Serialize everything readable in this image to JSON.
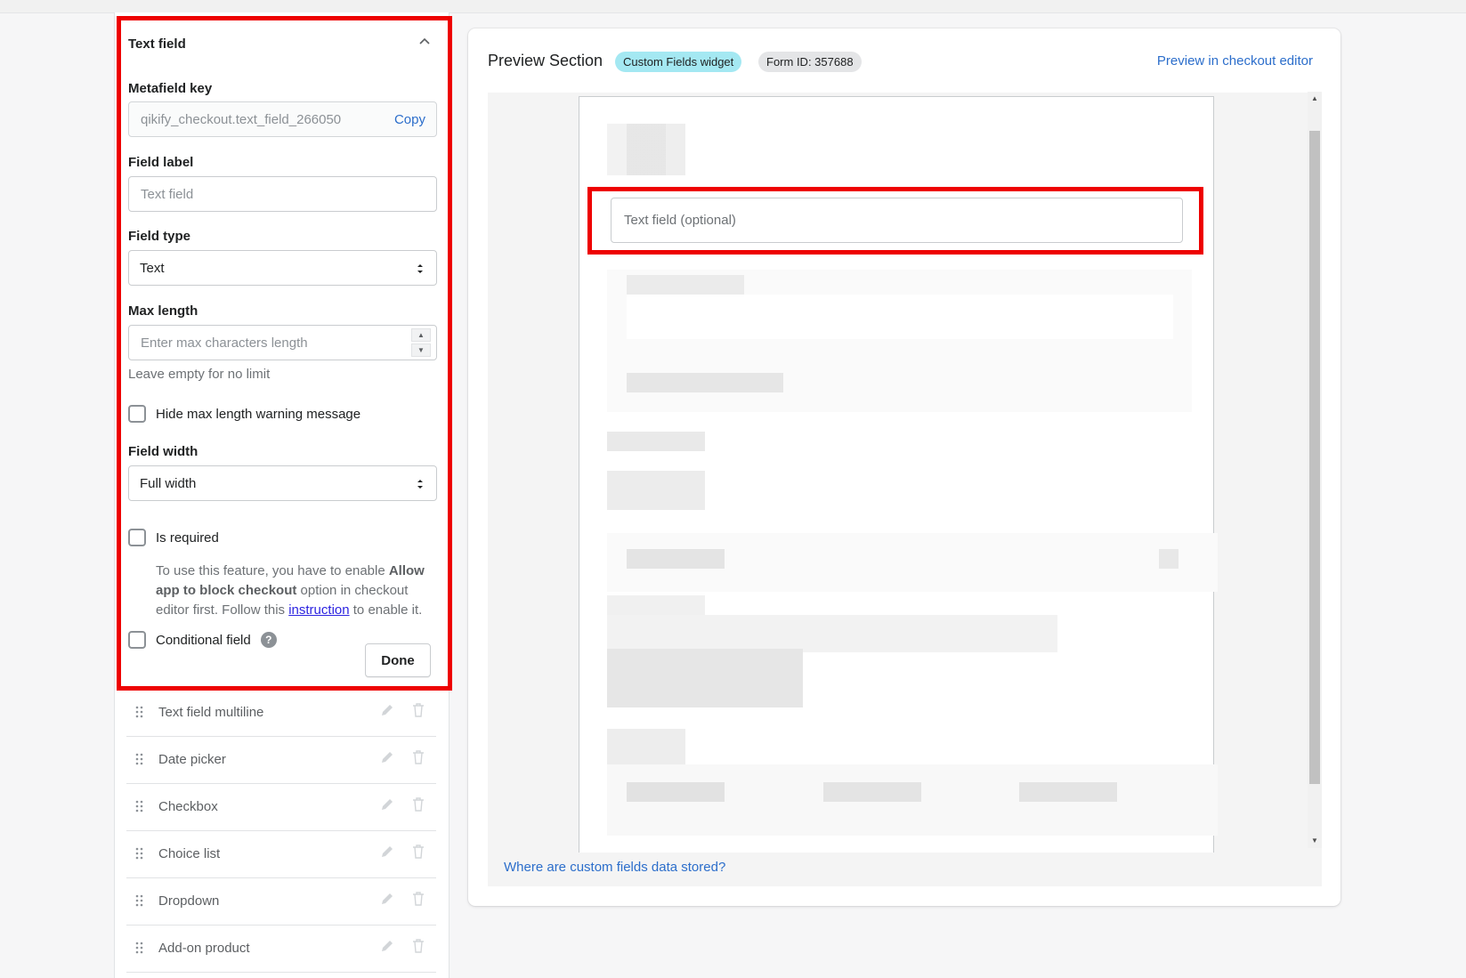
{
  "editor": {
    "title": "Text field",
    "metafield_key": {
      "label": "Metafield key",
      "value": "qikify_checkout.text_field_266050",
      "copy_label": "Copy"
    },
    "field_label": {
      "label": "Field label",
      "placeholder": "Text field"
    },
    "field_type": {
      "label": "Field type",
      "value": "Text"
    },
    "max_length": {
      "label": "Max length",
      "placeholder": "Enter max characters length",
      "help": "Leave empty for no limit"
    },
    "hide_warning": {
      "label": "Hide max length warning message",
      "checked": false
    },
    "field_width": {
      "label": "Field width",
      "value": "Full width"
    },
    "is_required": {
      "label": "Is required",
      "checked": false,
      "note_prefix": "To use this feature, you have to enable ",
      "note_bold": "Allow app to block checkout",
      "note_middle": " option in checkout editor first. Follow this ",
      "note_link": "instruction",
      "note_suffix": " to enable it."
    },
    "conditional": {
      "label": "Conditional field",
      "help_glyph": "?",
      "checked": false
    },
    "done_label": "Done"
  },
  "field_list": [
    {
      "name": "Text field multiline"
    },
    {
      "name": "Date picker"
    },
    {
      "name": "Checkbox"
    },
    {
      "name": "Choice list"
    },
    {
      "name": "Dropdown"
    },
    {
      "name": "Add-on product"
    }
  ],
  "preview": {
    "title": "Preview Section",
    "badge_widget": "Custom Fields widget",
    "badge_form": "Form ID: 357688",
    "editor_link": "Preview in checkout editor",
    "input_placeholder": "Text field (optional)",
    "stored_link": "Where are custom fields data stored?"
  },
  "colors": {
    "highlight": "#ee0000",
    "link": "#2c6ecb",
    "badge_teal": "#a4e8f2",
    "badge_gray": "#e4e5e7"
  }
}
